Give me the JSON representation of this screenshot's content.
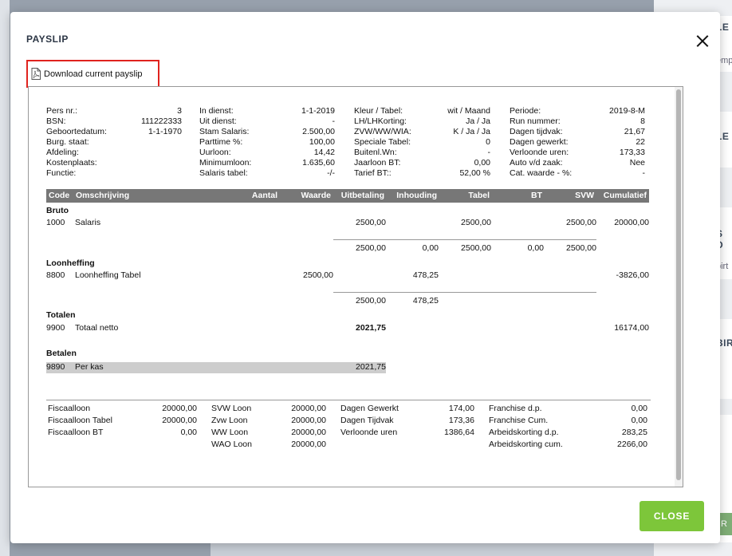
{
  "background": {
    "items": [
      "LE",
      "emp",
      "LE",
      "S D",
      "birt",
      "BIR",
      "R"
    ]
  },
  "modal": {
    "title": "PAYSLIP",
    "download_label": "Download current payslip",
    "close_button": "CLOSE"
  },
  "payslip": {
    "info_col1": [
      {
        "label": "Pers nr.:",
        "value": "3"
      },
      {
        "label": "BSN:",
        "value": "111222333"
      },
      {
        "label": "Geboortedatum:",
        "value": "1-1-1970"
      },
      {
        "label": "Burg. staat:",
        "value": ""
      },
      {
        "label": "Afdeling:",
        "value": ""
      },
      {
        "label": "Kostenplaats:",
        "value": ""
      },
      {
        "label": "Functie:",
        "value": ""
      }
    ],
    "info_col2": [
      {
        "label": "In dienst:",
        "value": "1-1-2019"
      },
      {
        "label": "Uit dienst:",
        "value": "-"
      },
      {
        "label": "Stam Salaris:",
        "value": "2.500,00"
      },
      {
        "label": "Parttime %:",
        "value": "100,00"
      },
      {
        "label": "Uurloon:",
        "value": "14,42"
      },
      {
        "label": "Minimumloon:",
        "value": "1.635,60"
      },
      {
        "label": "Salaris tabel:",
        "value": "-/-"
      }
    ],
    "info_col3": [
      {
        "label": "Kleur / Tabel:",
        "value": "wit / Maand"
      },
      {
        "label": "LH/LHKorting:",
        "value": "Ja / Ja"
      },
      {
        "label": "ZVW/WW/WIA:",
        "value": "K / Ja / Ja"
      },
      {
        "label": "Speciale Tabel:",
        "value": "0"
      },
      {
        "label": "Buitenl.Wn:",
        "value": "-"
      },
      {
        "label": "Jaarloon BT:",
        "value": "0,00"
      },
      {
        "label": "Tarief BT::",
        "value": "52,00 %"
      }
    ],
    "info_col4": [
      {
        "label": "Periode:",
        "value": "2019-8-M"
      },
      {
        "label": "Run nummer:",
        "value": "8"
      },
      {
        "label": "Dagen tijdvak:",
        "value": "21,67"
      },
      {
        "label": "Dagen gewerkt:",
        "value": "22"
      },
      {
        "label": "Verloonde uren:",
        "value": "173,33"
      },
      {
        "label": "Auto v/d zaak:",
        "value": "Nee"
      },
      {
        "label": "Cat. waarde - %:",
        "value": "-"
      }
    ],
    "columns": [
      "Code",
      "Omschrijving",
      "Aantal",
      "Waarde",
      "Uitbetaling",
      "Inhouding",
      "Tabel",
      "BT",
      "SVW",
      "Cumulatief"
    ],
    "sections": {
      "bruto": {
        "title": "Bruto",
        "code": "1000",
        "desc": "Salaris",
        "uitbetaling": "2500,00",
        "tabel": "2500,00",
        "svw": "2500,00",
        "cumulatief": "20000,00",
        "sub_uitbetaling": "2500,00",
        "sub_inhouding": "0,00",
        "sub_tabel": "2500,00",
        "sub_bt": "0,00",
        "sub_svw": "2500,00"
      },
      "loonheffing": {
        "title": "Loonheffing",
        "code": "8800",
        "desc": "Loonheffing Tabel",
        "waarde": "2500,00",
        "inhouding": "478,25",
        "cumulatief": "-3826,00",
        "sub_uitbetaling": "2500,00",
        "sub_inhouding": "478,25"
      },
      "totalen": {
        "title": "Totalen",
        "code": "9900",
        "desc": "Totaal netto",
        "uitbetaling": "2021,75",
        "cumulatief": "16174,00"
      },
      "betalen": {
        "title": "Betalen",
        "code": "9890",
        "desc": "Per kas",
        "uitbetaling": "2021,75"
      }
    },
    "footer_col1": [
      {
        "label": "Fiscaalloon",
        "value": "20000,00"
      },
      {
        "label": "Fiscaalloon Tabel",
        "value": "20000,00"
      },
      {
        "label": "Fiscaalloon BT",
        "value": "0,00"
      }
    ],
    "footer_col2": [
      {
        "label": "SVW Loon",
        "value": "20000,00"
      },
      {
        "label": "Zvw Loon",
        "value": "20000,00"
      },
      {
        "label": "WW Loon",
        "value": "20000,00"
      },
      {
        "label": "WAO Loon",
        "value": "20000,00"
      }
    ],
    "footer_col3": [
      {
        "label": "Dagen Gewerkt",
        "value": "174,00"
      },
      {
        "label": "Dagen Tijdvak",
        "value": "173,36"
      },
      {
        "label": "Verloonde uren",
        "value": "1386,64"
      }
    ],
    "footer_col4": [
      {
        "label": "Franchise d.p.",
        "value": "0,00"
      },
      {
        "label": "Franchise Cum.",
        "value": "0,00"
      },
      {
        "label": "Arbeidskorting d.p.",
        "value": "283,25"
      },
      {
        "label": "Arbeidskorting cum.",
        "value": "2266,00"
      }
    ]
  },
  "colors": {
    "accent_green": "#7dc63a",
    "highlight_red": "#e0231e",
    "header_grey": "#777777"
  }
}
